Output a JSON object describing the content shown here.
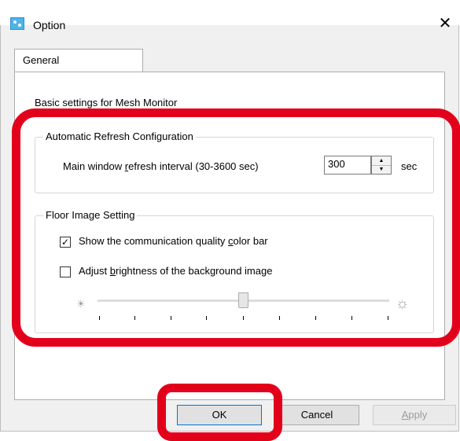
{
  "window": {
    "title": "Option",
    "close_symbol": "✕"
  },
  "tabs": [
    {
      "label": "General"
    }
  ],
  "general": {
    "basic_settings_label": "Basic settings for Mesh Monitor",
    "refresh_group": {
      "title": "Automatic Refresh Configuration",
      "interval_label": "Main window refresh interval (30-3600 sec)",
      "interval_value": "300",
      "unit": "sec"
    },
    "floor_group": {
      "title": "Floor Image Setting",
      "show_color_bar": {
        "label": "Show the communication quality color bar",
        "checked": true
      },
      "adjust_brightness": {
        "label": "Adjust brightness of the background image",
        "checked": false
      },
      "brightness_level": 0.5
    }
  },
  "buttons": {
    "ok": "OK",
    "cancel": "Cancel",
    "apply": "Apply"
  },
  "icons": {
    "app": "app-icon",
    "sun_small": "sun-small-icon",
    "sun_large": "sun-large-icon"
  },
  "colors": {
    "annotation": "#e3001b",
    "focus": "#0078d7"
  }
}
